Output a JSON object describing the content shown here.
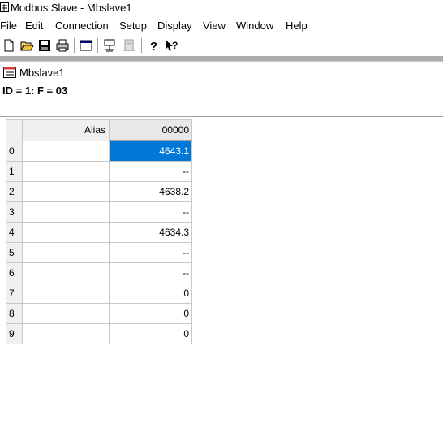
{
  "window": {
    "title": "Modbus Slave - Mbslave1"
  },
  "menu": [
    "File",
    "Edit",
    "Connection",
    "Setup",
    "Display",
    "View",
    "Window",
    "Help"
  ],
  "toolbar": {
    "buttons": [
      "new-icon",
      "open-icon",
      "save-icon",
      "print-icon",
      "window-icon",
      "disconnect-icon",
      "connect-icon",
      "help-icon",
      "context-help-icon"
    ]
  },
  "child": {
    "title": "Mbslave1",
    "info": "ID = 1: F = 03"
  },
  "grid": {
    "alias_header": "Alias",
    "value_header": "00000",
    "rows": [
      {
        "index": "0",
        "alias": "",
        "value": "4643.1",
        "selected": true
      },
      {
        "index": "1",
        "alias": "",
        "value": "--"
      },
      {
        "index": "2",
        "alias": "",
        "value": "4638.2"
      },
      {
        "index": "3",
        "alias": "",
        "value": "--"
      },
      {
        "index": "4",
        "alias": "",
        "value": "4634.3"
      },
      {
        "index": "5",
        "alias": "",
        "value": "--"
      },
      {
        "index": "6",
        "alias": "",
        "value": "--"
      },
      {
        "index": "7",
        "alias": "",
        "value": "0"
      },
      {
        "index": "8",
        "alias": "",
        "value": "0"
      },
      {
        "index": "9",
        "alias": "",
        "value": "0"
      }
    ]
  },
  "colors": {
    "selection": "#0078d7"
  }
}
